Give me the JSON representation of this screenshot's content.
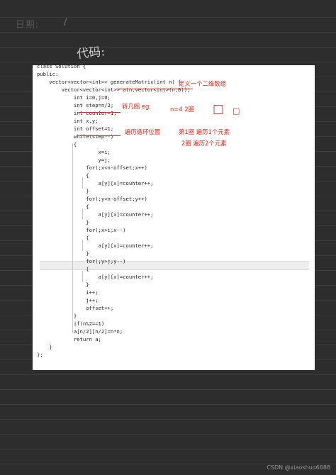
{
  "page": {
    "date_label": "日期:",
    "date_sep": "/",
    "heading": "代码:",
    "watermark": "CSDN @xiaoshuo6688"
  },
  "code": {
    "lines": [
      "class Solution {",
      "public:",
      "    vector<vector<int>> generateMatrix(int n) {",
      "        vector<vector<int>> a(n,vector<int>(n,0));",
      "            int i=0,j=0;",
      "            int step=n/2;",
      "            int counter=1;",
      "            int x,y;",
      "            int offset=1;",
      "            while(step--)",
      "            {",
      "                    x=i;",
      "                    y=j;",
      "                for(;x<n-offset;x++)",
      "                {",
      "                    a[y][x]=counter++;",
      "                }",
      "                for(;y<n-offset;y++)",
      "                {",
      "                    a[y][x]=counter++;",
      "                }",
      "                for(;x>i;x--)",
      "                {",
      "                    a[y][x]=counter++;",
      "                }",
      "                for(;y>j;y--)",
      "                {",
      "                    a[y][x]=counter++;",
      "                }",
      "                i++;",
      "                j++;",
      "                offset++;",
      "            }",
      "            if(n%2==1)",
      "            a[n/2][n/2]=n*n;",
      "            return a;",
      "    }",
      "};"
    ]
  },
  "annotations": {
    "note_define_array": "定义一个二维数组",
    "note_turns": "转几圈 eg:",
    "note_example": "n=4  2圈",
    "note_loop_pos": "遍历循环位置",
    "note_first_round": "第1圈 遍历1个元素",
    "note_second_round": "2圈 遍历2个元素"
  },
  "colors": {
    "ink": "#e0261a",
    "background": "#2d2d2d",
    "code_bg": "#ffffff"
  }
}
